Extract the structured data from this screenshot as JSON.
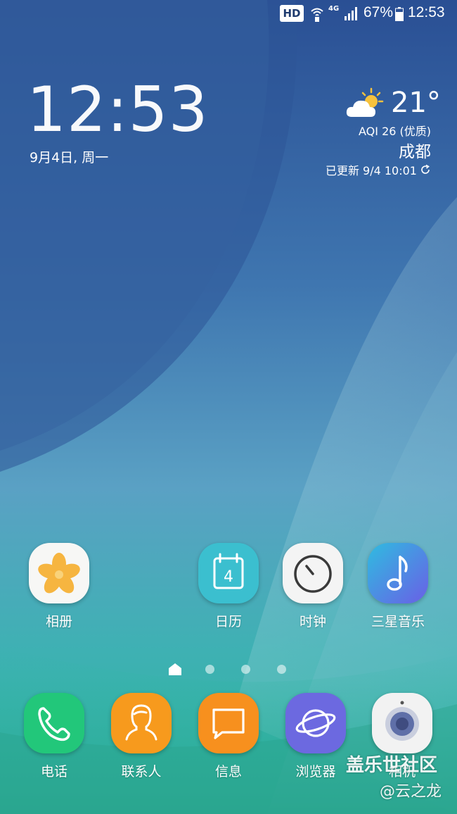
{
  "status_bar": {
    "hd_badge": "HD",
    "network": "4G",
    "battery": "67%",
    "time": "12:53",
    "icons": [
      "hd-icon",
      "wifi-calling-icon",
      "signal-icon",
      "battery-icon"
    ]
  },
  "clock_widget": {
    "time": "12:53",
    "date": "9月4日, 周一"
  },
  "weather_widget": {
    "icon": "partly-sunny-icon",
    "temperature": "21°",
    "aqi": "AQI 26 (优质)",
    "city": "成都",
    "updated": "已更新 9/4  10:01",
    "refresh_icon": "refresh-icon"
  },
  "home_apps": [
    {
      "label": "相册",
      "icon": "gallery-icon"
    },
    {
      "label": "日历",
      "icon": "calendar-icon",
      "day": "4"
    },
    {
      "label": "时钟",
      "icon": "clock-icon"
    },
    {
      "label": "三星音乐",
      "icon": "music-icon"
    }
  ],
  "page_indicator": {
    "pages": 4,
    "current": 0,
    "home_icon": "home-icon"
  },
  "dock_apps": [
    {
      "label": "电话",
      "icon": "phone-icon"
    },
    {
      "label": "联系人",
      "icon": "contacts-icon"
    },
    {
      "label": "信息",
      "icon": "messages-icon"
    },
    {
      "label": "浏览器",
      "icon": "browser-icon"
    },
    {
      "label": "相机",
      "icon": "camera-icon"
    }
  ],
  "watermark": {
    "line1": "盖乐世社区",
    "line2": "@云之龙"
  },
  "colors": {
    "gallery_bg": "#f7f7f5",
    "gallery_flower": "#f6b540",
    "calendar_bg": "#3bbfcf",
    "clock_bg": "#f4f4f4",
    "music_bg": "#5a7de8",
    "phone_bg": "#22c77a",
    "contacts_bg": "#f79a1d",
    "messages_bg": "#f7901e",
    "browser_bg": "#6c69e0",
    "camera_bg": "#f2f2f2"
  }
}
